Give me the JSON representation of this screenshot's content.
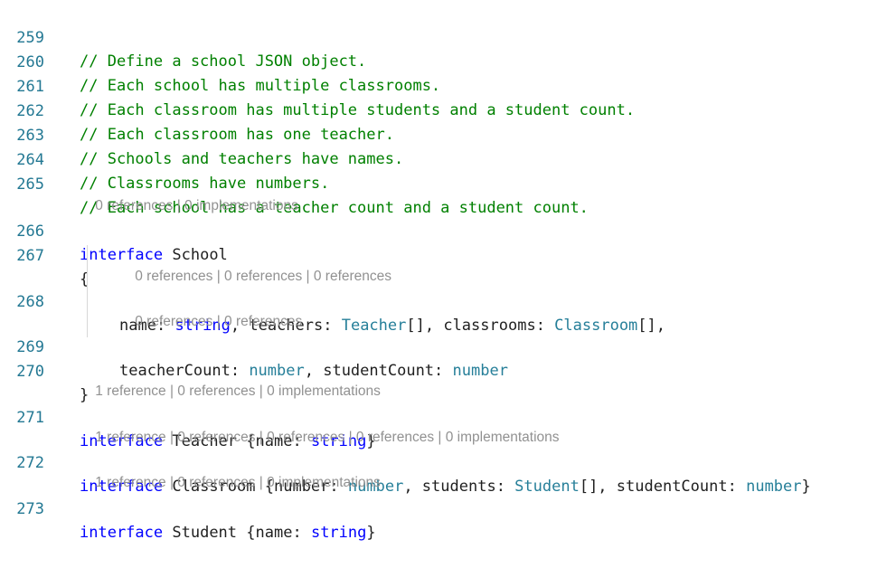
{
  "lines": {
    "l259": {
      "num": "259",
      "text": "// Define a school JSON object."
    },
    "l260": {
      "num": "260",
      "text": "// Each school has multiple classrooms."
    },
    "l261": {
      "num": "261",
      "text": "// Each classroom has multiple students and a student count."
    },
    "l262": {
      "num": "262",
      "text": "// Each classroom has one teacher."
    },
    "l263": {
      "num": "263",
      "text": "// Schools and teachers have names."
    },
    "l264": {
      "num": "264",
      "text": "// Classrooms have numbers."
    },
    "l265": {
      "num": "265",
      "text": "// Each school has a teacher count and a student count."
    },
    "l266": {
      "num": "266",
      "kw": "interface",
      "name": "School"
    },
    "l267": {
      "num": "267",
      "text": "{"
    },
    "l268": {
      "num": "268",
      "p1": "name",
      "t1": "string",
      "p2": "teachers",
      "t2": "Teacher",
      "p3": "classrooms",
      "t3": "Classroom"
    },
    "l269": {
      "num": "269",
      "p1": "teacherCount",
      "t1": "number",
      "p2": "studentCount",
      "t2": "number"
    },
    "l270": {
      "num": "270",
      "text": "}"
    },
    "l271": {
      "num": "271",
      "kw": "interface",
      "name": "Teacher",
      "p1": "name",
      "t1": "string"
    },
    "l272": {
      "num": "272",
      "kw": "interface",
      "name": "Classroom",
      "p1": "number",
      "t1": "number",
      "p2": "students",
      "t2": "Student",
      "p3": "studentCount",
      "t3": "number"
    },
    "l273": {
      "num": "273",
      "kw": "interface",
      "name": "Student",
      "p1": "name",
      "t1": "string"
    }
  },
  "codelens": {
    "school": [
      "0 references",
      "0 implementations"
    ],
    "school_line1": [
      "0 references",
      "0 references",
      "0 references"
    ],
    "school_line2": [
      "0 references",
      "0 references"
    ],
    "teacher": [
      "1 reference",
      "0 references",
      "0 implementations"
    ],
    "classroom": [
      "1 reference",
      "0 references",
      "0 references",
      "0 references",
      "0 implementations"
    ],
    "student": [
      "1 reference",
      "0 references",
      "0 implementations"
    ]
  },
  "colors": {
    "comment": "#008000",
    "keyword": "#0000ff",
    "type": "#267f99",
    "line_number": "#237893",
    "codelens": "#919191"
  }
}
